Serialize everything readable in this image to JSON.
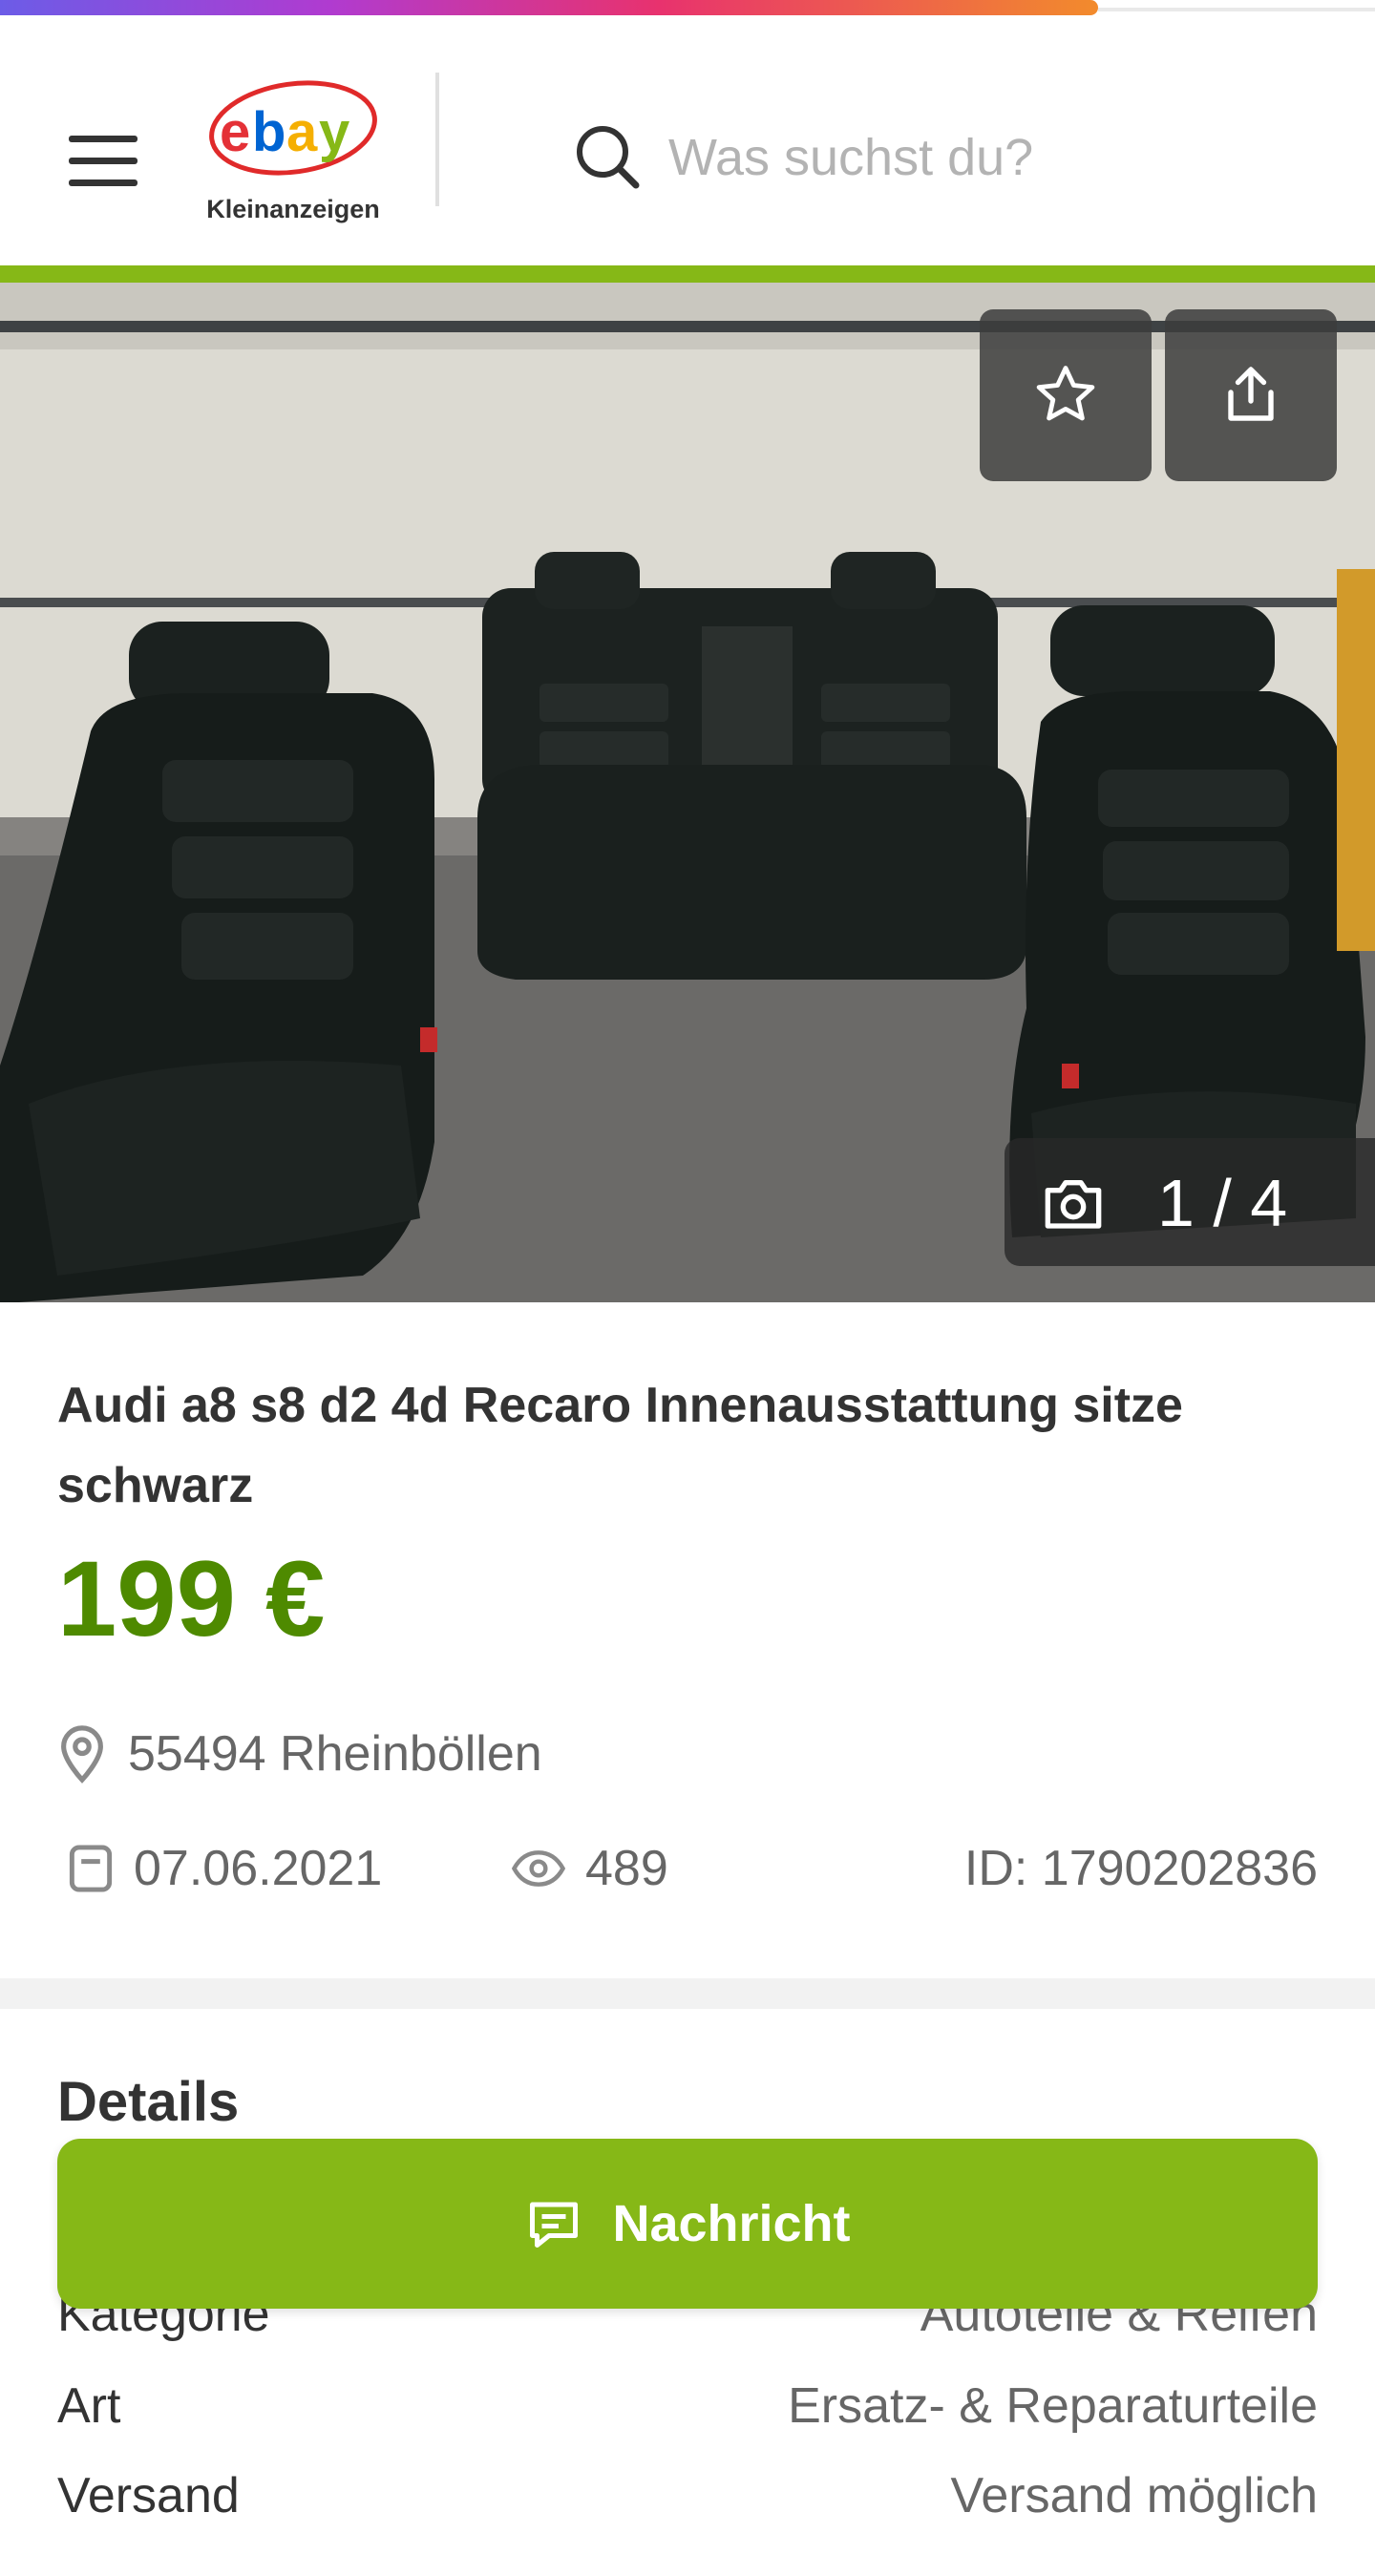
{
  "header": {
    "logo_brand": "ebay",
    "logo_sub": "Kleinanzeigen",
    "search_placeholder": "Was suchst du?"
  },
  "gallery": {
    "counter": "1 / 4",
    "favorite_icon": "star-icon",
    "share_icon": "share-icon",
    "camera_icon": "camera-icon"
  },
  "listing": {
    "title": "Audi a8 s8 d2 4d Recaro Innenausstattung sitze schwarz",
    "price": "199 €",
    "location": "55494 Rheinböllen",
    "date": "07.06.2021",
    "views": "489",
    "id": "ID: 1790202836"
  },
  "details": {
    "heading": "Details",
    "rows": [
      {
        "label": "Kategorie",
        "value": "Autoteile & Reifen"
      },
      {
        "label": "Art",
        "value": "Ersatz- & Reparaturteile"
      },
      {
        "label": "Versand",
        "value": "Versand möglich"
      }
    ]
  },
  "actions": {
    "message_label": "Nachricht"
  },
  "colors": {
    "accent_green": "#86b817",
    "price_green": "#4e8a00"
  }
}
